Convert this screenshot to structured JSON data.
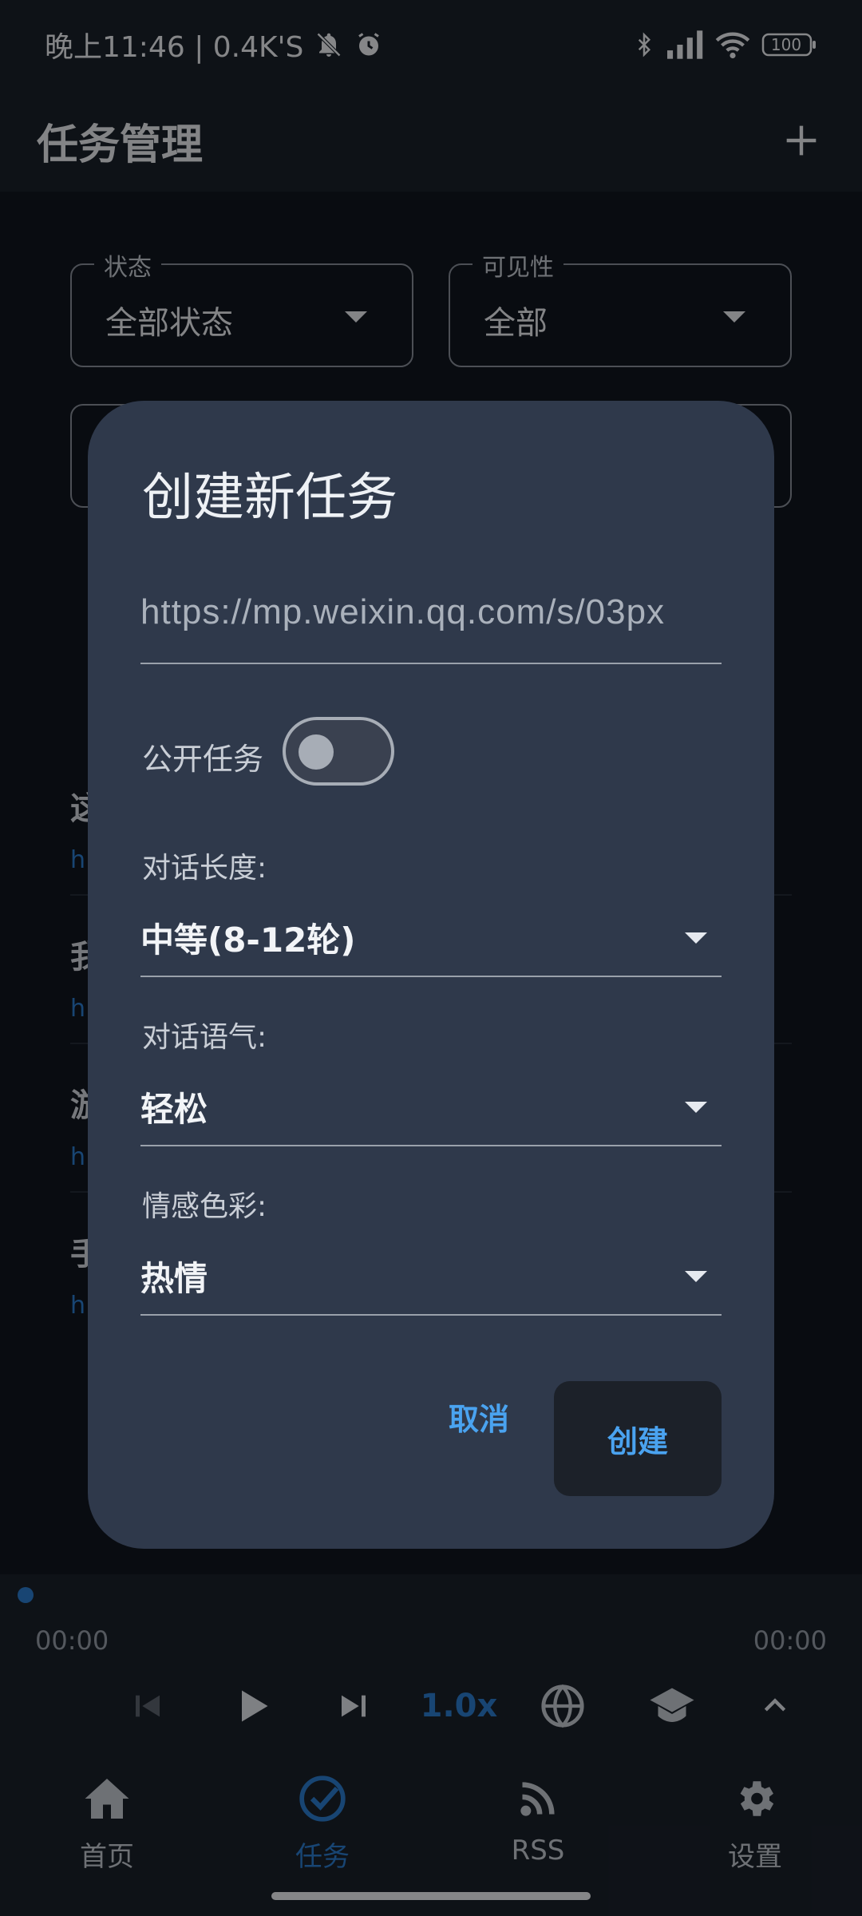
{
  "status_bar": {
    "time_speed": "晚上11:46 | 0.4K'S",
    "battery": "100",
    "icons": [
      "bell-off-icon",
      "alarm-icon",
      "bluetooth-icon",
      "signal-icon",
      "wifi-icon",
      "battery-icon"
    ]
  },
  "app_bar": {
    "title": "任务管理",
    "add_icon": "plus-icon"
  },
  "filters": {
    "status_label": "状态",
    "status_value": "全部状态",
    "visibility_label": "可见性",
    "visibility_value": "全部"
  },
  "background_list": [
    {
      "title": "这",
      "link": "h"
    },
    {
      "title": "我",
      "link": "h"
    },
    {
      "title": "游",
      "link": "h"
    },
    {
      "title": "手",
      "link": "h"
    }
  ],
  "player": {
    "current_time": "00:00",
    "total_time": "00:00",
    "speed": "1.0x",
    "icons": [
      "skip-previous-icon",
      "play-icon",
      "skip-next-icon",
      "globe-icon",
      "school-icon",
      "chevron-up-icon"
    ]
  },
  "bottom_nav": {
    "items": [
      {
        "label": "首页",
        "icon": "home-icon",
        "active": false
      },
      {
        "label": "任务",
        "icon": "task-check-icon",
        "active": true
      },
      {
        "label": "RSS",
        "icon": "rss-icon",
        "active": false
      },
      {
        "label": "设置",
        "icon": "gear-icon",
        "active": false
      }
    ]
  },
  "dialog": {
    "title": "创建新任务",
    "url_value": "https://mp.weixin.qq.com/s/03px",
    "public_label": "公开任务",
    "public_enabled": false,
    "length_label": "对话长度:",
    "length_value": "中等(8-12轮)",
    "tone_label": "对话语气:",
    "tone_value": "轻松",
    "emotion_label": "情感色彩:",
    "emotion_value": "热情",
    "cancel_label": "取消",
    "create_label": "创建"
  },
  "colors": {
    "accent": "#4aa3f0",
    "dialog_bg": "#2f394b",
    "page_bg": "#11161f"
  }
}
